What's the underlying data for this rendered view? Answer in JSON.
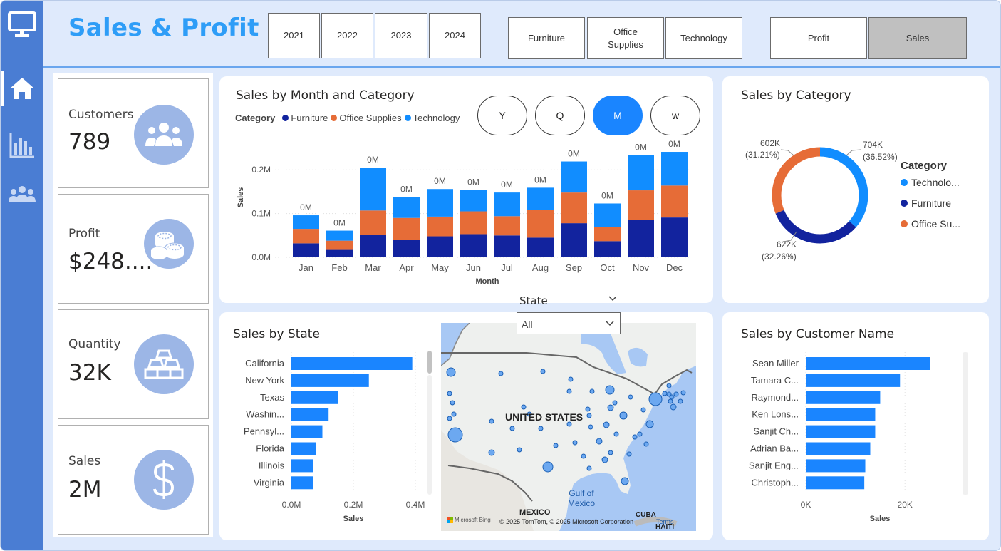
{
  "header": {
    "title": "Sales & Profit"
  },
  "sidebar": {
    "items": [
      {
        "name": "monitor-icon"
      },
      {
        "name": "home-icon",
        "active": true
      },
      {
        "name": "bar-chart-icon"
      },
      {
        "name": "users-icon"
      }
    ]
  },
  "year_slicer": [
    "2021",
    "2022",
    "2023",
    "2024"
  ],
  "category_slicer": [
    "Furniture",
    "Office\nSupplies",
    "Technology"
  ],
  "measure_slicer": {
    "items": [
      "Profit",
      "Sales"
    ],
    "selected": "Sales"
  },
  "kpis": [
    {
      "label": "Customers",
      "value": "789",
      "icon": "group-icon"
    },
    {
      "label": "Profit",
      "value": "$248....",
      "icon": "coins-icon"
    },
    {
      "label": "Quantity",
      "value": "32K",
      "icon": "gold-bars-icon"
    },
    {
      "label": "Sales",
      "value": "2M",
      "icon": "dollar-icon"
    }
  ],
  "colors": {
    "furniture": "#12239e",
    "office_supplies": "#e66c37",
    "technology": "#118dff",
    "bar": "#1a85ff",
    "accent": "#2e9df7"
  },
  "monthly": {
    "title": "Sales by Month and Category",
    "legend_title": "Category",
    "legend": [
      "Furniture",
      "Office Supplies",
      "Technology"
    ],
    "pills": [
      "Y",
      "Q",
      "M",
      "w"
    ],
    "selected_pill": "M",
    "state_label": "State",
    "state_value": "All"
  },
  "bycat": {
    "title": "Sales by Category",
    "legend_title": "Category",
    "legend": [
      "Technolo...",
      "Furniture",
      "Office Su..."
    ],
    "labels": [
      {
        "value": "704K",
        "pct": "(36.52%)"
      },
      {
        "value": "602K",
        "pct": "(31.21%)"
      },
      {
        "value": "622K",
        "pct": "(32.26%)"
      }
    ]
  },
  "state": {
    "title": "Sales by State",
    "map_country": "UNITED STATES",
    "map_gulf": "Gulf of\nMexico",
    "map_mexico": "MEXICO",
    "map_cuba": "CUBA",
    "map_haiti": "HAITI",
    "map_brand": "Microsoft Bing",
    "map_copyright": "© 2025 TomTom, © 2025 Microsoft Corporation",
    "map_terms": "Terms"
  },
  "customer": {
    "title": "Sales by Customer Name"
  },
  "chart_data": [
    {
      "type": "bar",
      "title": "Sales by Month and Category",
      "stacked": true,
      "categories": [
        "Jan",
        "Feb",
        "Mar",
        "Apr",
        "May",
        "Jun",
        "Jul",
        "Aug",
        "Sep",
        "Oct",
        "Nov",
        "Dec"
      ],
      "series": [
        {
          "name": "Furniture",
          "values": [
            0.032,
            0.017,
            0.051,
            0.04,
            0.048,
            0.053,
            0.05,
            0.045,
            0.078,
            0.037,
            0.085,
            0.091
          ]
        },
        {
          "name": "Office Supplies",
          "values": [
            0.033,
            0.021,
            0.056,
            0.05,
            0.045,
            0.052,
            0.044,
            0.063,
            0.07,
            0.032,
            0.068,
            0.073
          ]
        },
        {
          "name": "Technology",
          "values": [
            0.031,
            0.023,
            0.098,
            0.048,
            0.063,
            0.049,
            0.054,
            0.051,
            0.071,
            0.054,
            0.081,
            0.077
          ]
        }
      ],
      "data_labels": [
        "0M",
        "0M",
        "0M",
        "0M",
        "0M",
        "0M",
        "0M",
        "0M",
        "0M",
        "0M",
        "0M",
        "0M"
      ],
      "xlabel": "Month",
      "ylabel": "Sales",
      "yticks": [
        "0.0M",
        "0.1M",
        "0.2M"
      ],
      "ylim": [
        0,
        0.22
      ],
      "legend_position": "top-left"
    },
    {
      "type": "pie",
      "title": "Sales by Category",
      "donut": true,
      "labels": [
        "Technology",
        "Furniture",
        "Office Supplies"
      ],
      "values": [
        704,
        622,
        602
      ],
      "percentages": [
        36.52,
        32.26,
        31.21
      ],
      "legend_position": "right"
    },
    {
      "type": "bar",
      "orientation": "horizontal",
      "title": "Sales by State",
      "categories": [
        "California",
        "New York",
        "Texas",
        "Washin...",
        "Pennsyl...",
        "Florida",
        "Illinois",
        "Virginia"
      ],
      "values": [
        0.39,
        0.25,
        0.15,
        0.12,
        0.1,
        0.08,
        0.07,
        0.07
      ],
      "xlabel": "Sales",
      "xticks": [
        "0.0M",
        "0.2M",
        "0.4M"
      ],
      "xlim": [
        0,
        0.4
      ]
    },
    {
      "type": "bar",
      "orientation": "horizontal",
      "title": "Sales by Customer Name",
      "categories": [
        "Sean Miller",
        "Tamara C...",
        "Raymond...",
        "Ken Lons...",
        "Sanjit Ch...",
        "Adrian Ba...",
        "Sanjit Eng...",
        "Christoph..."
      ],
      "values": [
        25000,
        19000,
        15000,
        14000,
        14000,
        13000,
        12000,
        11800
      ],
      "xlabel": "Sales",
      "xticks": [
        "0K",
        "20K"
      ],
      "xlim": [
        0,
        27000
      ]
    }
  ]
}
